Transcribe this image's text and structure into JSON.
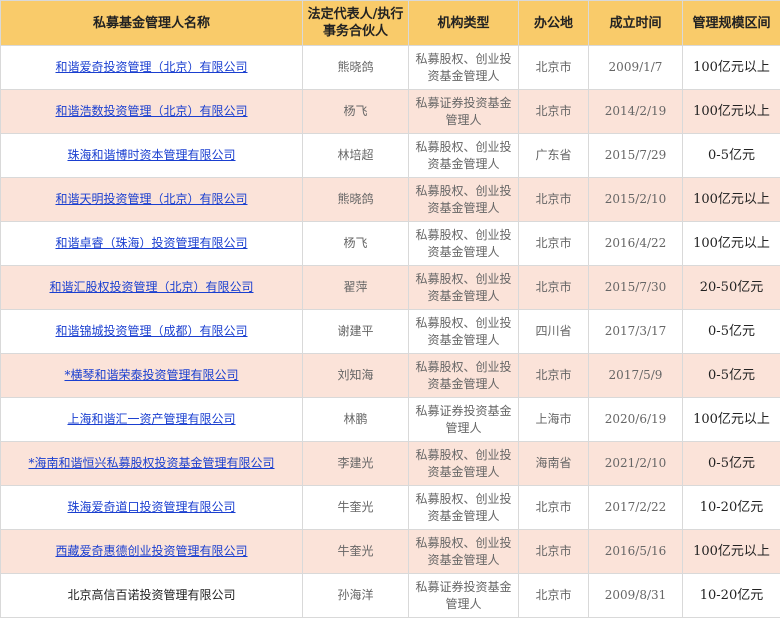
{
  "table": {
    "headers": [
      "私募基金管理人名称",
      "法定代表人/执行事务合伙人",
      "机构类型",
      "办公地",
      "成立时间",
      "管理规模区间"
    ],
    "rows": [
      {
        "name": "和谐爱奇投资管理（北京）有限公司",
        "rep": "熊晓鸽",
        "type": "私募股权、创业投资基金管理人",
        "place": "北京市",
        "date": "2009/1/7",
        "scale": "100亿元以上",
        "link": true
      },
      {
        "name": "和谐浩数投资管理（北京）有限公司",
        "rep": "杨飞",
        "type": "私募证券投资基金管理人",
        "place": "北京市",
        "date": "2014/2/19",
        "scale": "100亿元以上",
        "link": true
      },
      {
        "name": "珠海和谐博时资本管理有限公司",
        "rep": "林培超",
        "type": "私募股权、创业投资基金管理人",
        "place": "广东省",
        "date": "2015/7/29",
        "scale": "0-5亿元",
        "link": true
      },
      {
        "name": "和谐天明投资管理（北京）有限公司",
        "rep": "熊晓鸽",
        "type": "私募股权、创业投资基金管理人",
        "place": "北京市",
        "date": "2015/2/10",
        "scale": "100亿元以上",
        "link": true
      },
      {
        "name": "和谐卓睿（珠海）投资管理有限公司",
        "rep": "杨飞",
        "type": "私募股权、创业投资基金管理人",
        "place": "北京市",
        "date": "2016/4/22",
        "scale": "100亿元以上",
        "link": true
      },
      {
        "name": "和谐汇股权投资管理（北京）有限公司",
        "rep": "翟萍",
        "type": "私募股权、创业投资基金管理人",
        "place": "北京市",
        "date": "2015/7/30",
        "scale": "20-50亿元",
        "link": true
      },
      {
        "name": "和谐锦城投资管理（成都）有限公司",
        "rep": "谢建平",
        "type": "私募股权、创业投资基金管理人",
        "place": "四川省",
        "date": "2017/3/17",
        "scale": "0-5亿元",
        "link": true
      },
      {
        "name": "*横琴和谐荣泰投资管理有限公司",
        "rep": "刘知海",
        "type": "私募股权、创业投资基金管理人",
        "place": "北京市",
        "date": "2017/5/9",
        "scale": "0-5亿元",
        "link": true
      },
      {
        "name": "上海和谐汇一资产管理有限公司",
        "rep": "林鹏",
        "type": "私募证券投资基金管理人",
        "place": "上海市",
        "date": "2020/6/19",
        "scale": "100亿元以上",
        "link": true
      },
      {
        "name": "*海南和谐恒兴私募股权投资基金管理有限公司",
        "rep": "李建光",
        "type": "私募股权、创业投资基金管理人",
        "place": "海南省",
        "date": "2021/2/10",
        "scale": "0-5亿元",
        "link": true
      },
      {
        "name": "珠海爱奇道口投资管理有限公司",
        "rep": "牛奎光",
        "type": "私募股权、创业投资基金管理人",
        "place": "北京市",
        "date": "2017/2/22",
        "scale": "10-20亿元",
        "link": true
      },
      {
        "name": "西藏爱奇惠德创业投资管理有限公司",
        "rep": "牛奎光",
        "type": "私募股权、创业投资基金管理人",
        "place": "北京市",
        "date": "2016/5/16",
        "scale": "100亿元以上",
        "link": true
      },
      {
        "name": "北京高信百诺投资管理有限公司",
        "rep": "孙海洋",
        "type": "私募证券投资基金管理人",
        "place": "北京市",
        "date": "2009/8/31",
        "scale": "10-20亿元",
        "link": false
      }
    ]
  },
  "colors": {
    "header_bg": "#f9cb6a",
    "alt_row_bg": "#fbe3d9",
    "link": "#1a3fd0"
  }
}
